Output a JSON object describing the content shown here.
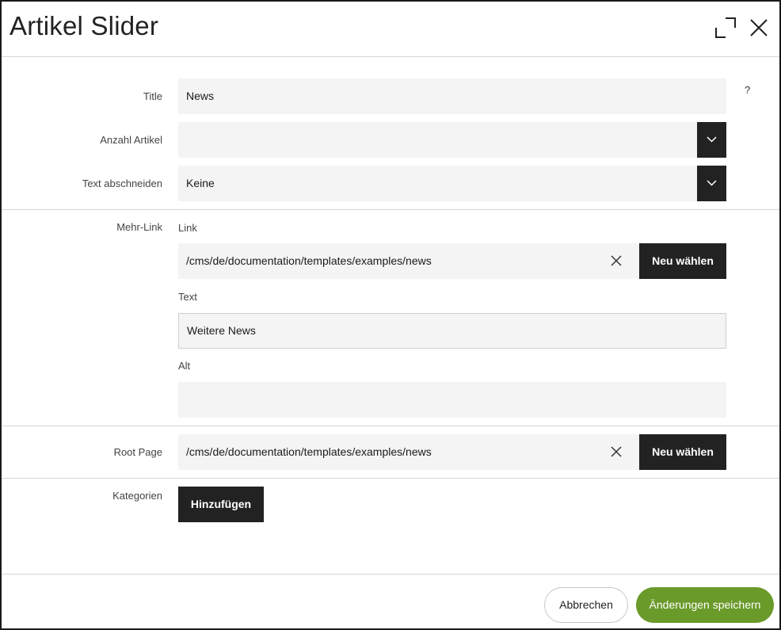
{
  "dialog": {
    "title": "Artikel Slider",
    "expand_icon": "expand-icon",
    "close_icon": "close-icon",
    "help": "?"
  },
  "form": {
    "title": {
      "label": "Title",
      "value": "News"
    },
    "anzahl_artikel": {
      "label": "Anzahl Artikel",
      "value": ""
    },
    "text_abschneiden": {
      "label": "Text abschneiden",
      "value": "Keine"
    },
    "mehr_link": {
      "label": "Mehr-Link",
      "link_label": "Link",
      "link_value": "/cms/de/documentation/templates/examples/news",
      "link_button": "Neu wählen",
      "text_label": "Text",
      "text_value": "Weitere News",
      "alt_label": "Alt",
      "alt_value": ""
    },
    "root_page": {
      "label": "Root Page",
      "value": "/cms/de/documentation/templates/examples/news",
      "button": "Neu wählen"
    },
    "kategorien": {
      "label": "Kategorien",
      "button": "Hinzufügen"
    }
  },
  "footer": {
    "cancel": "Abbrechen",
    "save": "Änderungen speichern"
  },
  "colors": {
    "accent_green": "#6a9a2a",
    "dark": "#222222",
    "field_bg": "#f4f4f4"
  }
}
